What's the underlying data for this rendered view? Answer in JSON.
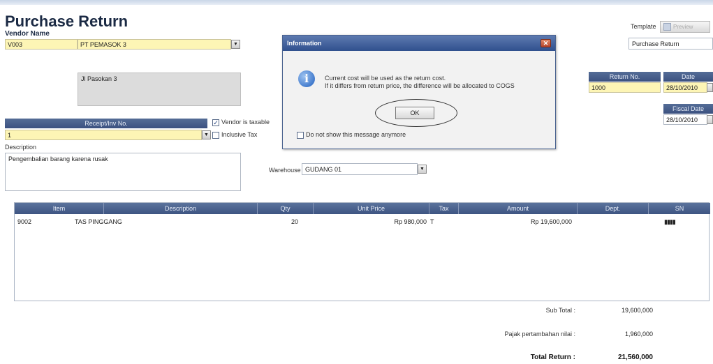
{
  "page": {
    "title": "Purchase Return"
  },
  "vendor": {
    "label": "Vendor Name",
    "code": "V003",
    "name": "PT PEMASOK 3",
    "address": "Jl Pasokan 3"
  },
  "receipt": {
    "header": "Receipt/Inv No.",
    "value": "1",
    "vendor_taxable_label": "Vendor is taxable",
    "vendor_taxable_checked": true,
    "inclusive_tax_label": "Inclusive Tax",
    "inclusive_tax_checked": false
  },
  "description": {
    "label": "Description",
    "value": "Pengembalian barang karena rusak"
  },
  "warehouse": {
    "label": "Warehouse",
    "value": "GUDANG 01"
  },
  "template": {
    "label": "Template",
    "button_label": "Preview",
    "value": "Purchase Return"
  },
  "return_no": {
    "header": "Return No.",
    "value": "1000"
  },
  "date": {
    "header": "Date",
    "value": "28/10/2010"
  },
  "fiscal_date": {
    "header": "Fiscal Date",
    "value": "28/10/2010"
  },
  "grid": {
    "columns": [
      "Item",
      "Description",
      "Qty",
      "Unit Price",
      "Tax",
      "Amount",
      "Dept.",
      "SN"
    ],
    "rows": [
      {
        "item": "9002",
        "description": "TAS PINGGANG",
        "qty": "20",
        "unit_price": "Rp 980,000",
        "tax": "T",
        "amount": "Rp 19,600,000",
        "dept": "",
        "sn": "▮▮▮▮"
      }
    ]
  },
  "totals": {
    "subtotal_label": "Sub Total :",
    "subtotal_value": "19,600,000",
    "vat_label": "Pajak pertambahan nilai :",
    "vat_value": "1,960,000",
    "total_label": "Total Return :",
    "total_value": "21,560,000"
  },
  "dialog": {
    "title": "Information",
    "line1": "Current cost will be used as the return cost.",
    "line2": "If it differs from return price, the difference will be allocated to COGS",
    "ok_label": "OK",
    "dont_show_label": "Do not show this message anymore",
    "dont_show_checked": false
  },
  "icons": {
    "dialog_icon": "info-icon",
    "dialog_close": "close-icon",
    "dropdown": "chevron-down-icon",
    "calendar": "calendar-icon"
  },
  "colors": {
    "header_bar": "#3b5180",
    "field_yellow": "#fdf5b5",
    "title_text": "#1b2a44"
  }
}
